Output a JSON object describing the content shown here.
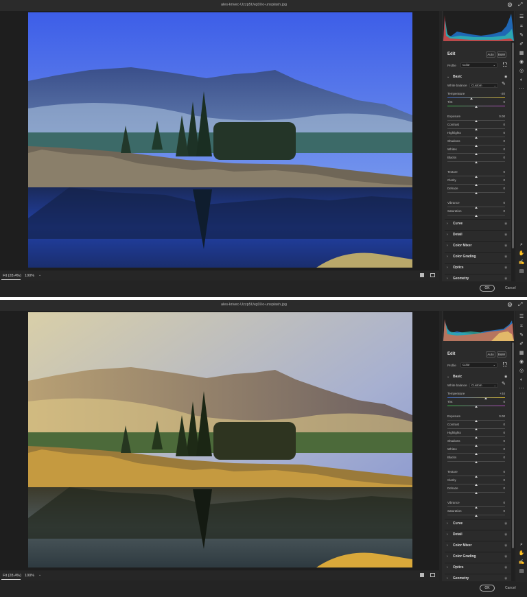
{
  "colors": {
    "app_bg": "#242424",
    "panel_bg": "#2b2b2b",
    "temperature_track_left": "#3a67c9",
    "temperature_track_right": "#d4b42a",
    "tint_track_left": "#3bbf4a",
    "tint_track_right": "#b944c4"
  },
  "icons": [
    "gear-icon",
    "expand-icon",
    "edit-sliders-icon",
    "crop-icon",
    "brush-icon",
    "heal-icon",
    "mask-icon",
    "redeye-icon",
    "presets-icon",
    "more-icon",
    "zoom-icon",
    "hand-icon",
    "sampler-icon",
    "grid-toggle-icon"
  ],
  "windows": [
    {
      "filename": "ales-krivec-Uzzp5Uvg0Xo-unsplash.jpg",
      "status": {
        "fit": "Fit (28,4%)",
        "zoom": "100%"
      },
      "edit": {
        "label": "Edit",
        "auto": "Auto",
        "bw": "B&W",
        "profile_label": "Profile",
        "profile_value": "Color"
      },
      "basic": {
        "title": "Basic",
        "white_balance_label": "White balance",
        "white_balance_value": "Custom",
        "sliders": [
          {
            "label": "Temperature",
            "value": "-20",
            "level": 0.42
          },
          {
            "label": "Tint",
            "value": "0",
            "level": 0.5
          },
          {
            "label": "Exposure",
            "value": "0.00",
            "level": 0.5
          },
          {
            "label": "Contrast",
            "value": "0",
            "level": 0.5
          },
          {
            "label": "Highlights",
            "value": "0",
            "level": 0.5
          },
          {
            "label": "Shadows",
            "value": "0",
            "level": 0.5
          },
          {
            "label": "Whites",
            "value": "0",
            "level": 0.5
          },
          {
            "label": "Blacks",
            "value": "0",
            "level": 0.5
          },
          {
            "label": "Texture",
            "value": "0",
            "level": 0.5
          },
          {
            "label": "Clarity",
            "value": "0",
            "level": 0.5
          },
          {
            "label": "Dehaze",
            "value": "0",
            "level": 0.5
          },
          {
            "label": "Vibrance",
            "value": "0",
            "level": 0.5
          },
          {
            "label": "Saturation",
            "value": "0",
            "level": 0.5
          }
        ]
      },
      "sections": [
        "Curve",
        "Detail",
        "Color Mixer",
        "Color Grading",
        "Optics",
        "Geometry"
      ],
      "footer": {
        "ok": "OK",
        "cancel": "Cancel"
      }
    },
    {
      "filename": "ales-krivec-Uzzp5Uvg0Xo-unsplash.jpg",
      "status": {
        "fit": "Fit (28,4%)",
        "zoom": "100%"
      },
      "edit": {
        "label": "Edit",
        "auto": "Auto",
        "bw": "B&W",
        "profile_label": "Profile",
        "profile_value": "Color"
      },
      "basic": {
        "title": "Basic",
        "white_balance_label": "White balance",
        "white_balance_value": "Custom",
        "sliders": [
          {
            "label": "Temperature",
            "value": "+34",
            "level": 0.67
          },
          {
            "label": "Tint",
            "value": "0",
            "level": 0.5
          },
          {
            "label": "Exposure",
            "value": "0.00",
            "level": 0.5
          },
          {
            "label": "Contrast",
            "value": "0",
            "level": 0.5
          },
          {
            "label": "Highlights",
            "value": "0",
            "level": 0.5
          },
          {
            "label": "Shadows",
            "value": "0",
            "level": 0.5
          },
          {
            "label": "Whites",
            "value": "0",
            "level": 0.5
          },
          {
            "label": "Blacks",
            "value": "0",
            "level": 0.5
          },
          {
            "label": "Texture",
            "value": "0",
            "level": 0.5
          },
          {
            "label": "Clarity",
            "value": "0",
            "level": 0.5
          },
          {
            "label": "Dehaze",
            "value": "0",
            "level": 0.5
          },
          {
            "label": "Vibrance",
            "value": "0",
            "level": 0.5
          },
          {
            "label": "Saturation",
            "value": "0",
            "level": 0.5
          }
        ]
      },
      "sections": [
        "Curve",
        "Detail",
        "Color Mixer",
        "Color Grading",
        "Optics",
        "Geometry"
      ],
      "footer": {
        "ok": "OK",
        "cancel": "Cancel"
      }
    }
  ]
}
